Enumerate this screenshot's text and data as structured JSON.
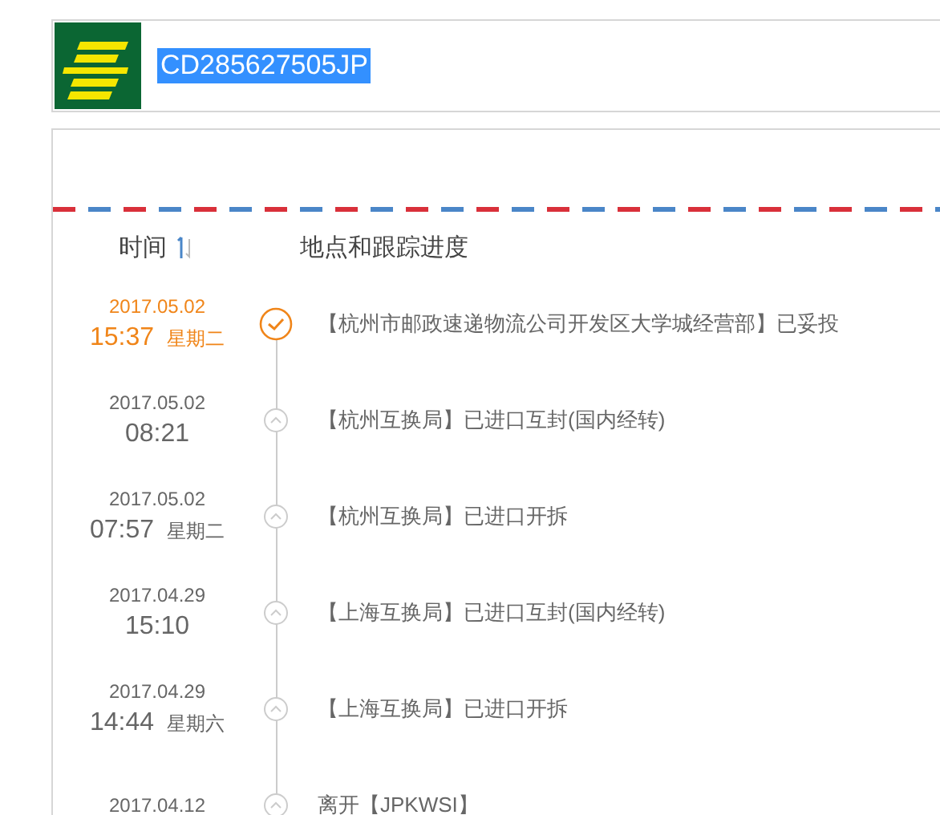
{
  "header": {
    "tracking_number": "CD285627505JP",
    "selected": true
  },
  "columns": [
    "时间",
    "地点和跟踪进度"
  ],
  "events": [
    {
      "date": "2017.05.02",
      "time": "15:37",
      "weekday": "星期二",
      "text": "【杭州市邮政速递物流公司开发区大学城经营部】已妥投",
      "current": true
    },
    {
      "date": "2017.05.02",
      "time": "08:21",
      "text": "【杭州互换局】已进口互封(国内经转)",
      "current": false
    },
    {
      "date": "2017.05.02",
      "time": "07:57",
      "weekday": "星期二",
      "text": "【杭州互换局】已进口开拆",
      "current": false
    },
    {
      "date": "2017.04.29",
      "time": "15:10",
      "text": "【上海互换局】已进口互封(国内经转)",
      "current": false
    },
    {
      "date": "2017.04.29",
      "time": "14:44",
      "weekday": "星期六",
      "text": "【上海互换局】已进口开拆",
      "current": false
    },
    {
      "date": "2017.04.12",
      "text": "离开【JPKWSI】",
      "current": false
    }
  ]
}
